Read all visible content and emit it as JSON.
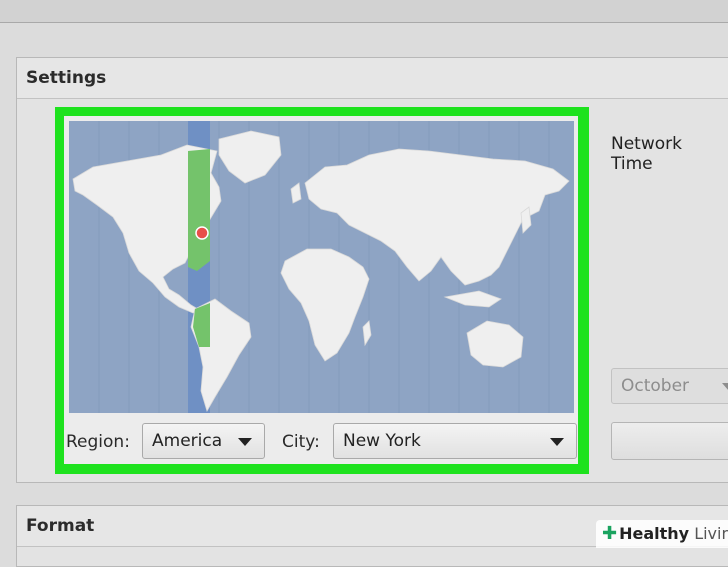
{
  "sections": {
    "settings_title": "Settings",
    "format_title": "Format"
  },
  "timezone": {
    "region_label": "Region:",
    "region_value": "America",
    "city_label": "City:",
    "city_value": "New York"
  },
  "right_panel": {
    "network_time_label": "Network Time",
    "month_value": "October"
  },
  "watermark": {
    "brand_bold": "Healthy",
    "brand_light": "Living"
  },
  "colors": {
    "highlight": "#1ee21e",
    "ocean": "#8ea4c4",
    "land": "#efefef",
    "selected_zone": "#74c36b",
    "location_marker": "#e8504a"
  }
}
